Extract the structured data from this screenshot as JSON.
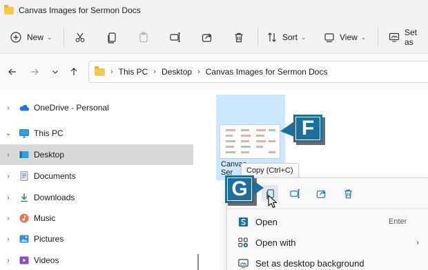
{
  "window": {
    "title": "Canvas Images for Sermon Docs"
  },
  "toolbar": {
    "new_label": "New",
    "sort_label": "Sort",
    "view_label": "View",
    "setas_label": "Set as"
  },
  "address": {
    "crumbs": [
      "This PC",
      "Desktop",
      "Canvas Images for Sermon Docs"
    ]
  },
  "nav": {
    "items": [
      {
        "label": "OneDrive - Personal",
        "icon": "cloud-icon"
      },
      {
        "label": "This PC",
        "icon": "computer-icon"
      },
      {
        "label": "Desktop",
        "icon": "desktop-icon",
        "selected": true
      },
      {
        "label": "Documents",
        "icon": "document-icon"
      },
      {
        "label": "Downloads",
        "icon": "download-icon"
      },
      {
        "label": "Music",
        "icon": "music-icon"
      },
      {
        "label": "Pictures",
        "icon": "pictures-icon"
      },
      {
        "label": "Videos",
        "icon": "videos-icon"
      }
    ]
  },
  "content": {
    "file_label": "Canvas\nSer"
  },
  "callouts": {
    "f": "F",
    "g": "G"
  },
  "tooltip": {
    "text": "Copy (Ctrl+C)"
  },
  "context_menu": {
    "items": [
      {
        "label": "Open",
        "shortcut": "Enter",
        "icon": "open-app-icon"
      },
      {
        "label": "Open with",
        "submenu_glyph": "›",
        "icon": "open-with-icon"
      },
      {
        "label": "Set as desktop background",
        "icon": "desktop-background-icon"
      }
    ]
  },
  "colors": {
    "accent": "#1a6ea0",
    "selection": "#cce8ff",
    "nav_selected": "#d9d9d9"
  }
}
